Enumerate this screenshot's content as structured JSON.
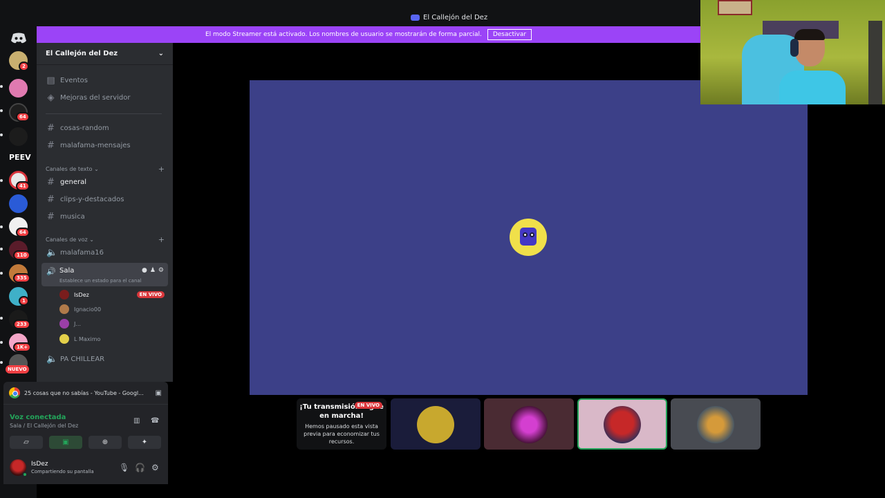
{
  "window": {
    "title": "El Callejón del Dez"
  },
  "banner": {
    "text": "El modo Streamer está activado. Los nombres de usuario se mostrarán de forma parcial.",
    "button": "Desactivar"
  },
  "rail": {
    "badges": [
      "2",
      "64",
      "41",
      "64",
      "110",
      "335",
      "1",
      "233",
      "1K+"
    ],
    "peev": "PEEV",
    "nuevo": "NUEVO"
  },
  "server": {
    "name": "El Callejón del Dez",
    "top_items": [
      {
        "icon": "calendar-icon",
        "label": "Eventos"
      },
      {
        "icon": "boost-icon",
        "label": "Mejoras del servidor"
      }
    ],
    "loose_channels": [
      "cosas-random",
      "malafama-mensajes"
    ],
    "text_category": "Canales de texto",
    "text_channels": [
      "general",
      "clips-y-destacados",
      "musica"
    ],
    "voice_category": "Canales de voz",
    "voice_channels": {
      "first": "malafama16",
      "active": {
        "name": "Sala",
        "status": "Establece un estado para el canal"
      },
      "last": "PA CHILLEAR"
    },
    "voice_users": [
      {
        "name": "IsDez",
        "live": "EN VIVO",
        "color": "#7a1d1d"
      },
      {
        "name": "Ignacio00",
        "color": "#b07a4a"
      },
      {
        "name": "J...",
        "color": "#9b3fa8"
      },
      {
        "name": "L Maximo",
        "color": "#e3d04a"
      }
    ]
  },
  "activity": {
    "text": "25 cosas que no sabías - YouTube - Googl..."
  },
  "voice_panel": {
    "status": "Voz conectada",
    "location": "Sala / El Callejón del Dez"
  },
  "user": {
    "name": "IsDez",
    "status": "Compartiendo su pantalla"
  },
  "stream_tile": {
    "title": "¡Tu transmisión sigue en marcha!",
    "live": "EN VIVO",
    "text": "Hemos pausado esta vista previa para economizar tus recursos."
  },
  "colors": {
    "accent": "#5865f2",
    "streamer_banner": "#9b44f7",
    "stage": "#3c4088",
    "online": "#23a55a",
    "live": "#da373c"
  }
}
